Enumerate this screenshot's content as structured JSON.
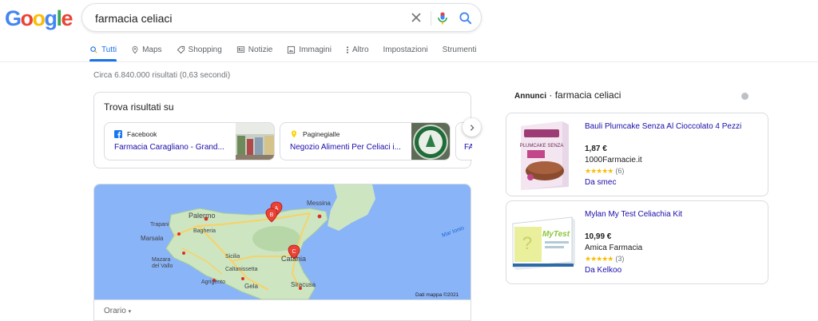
{
  "logo": {
    "letters": [
      "G",
      "o",
      "o",
      "g",
      "l",
      "e"
    ]
  },
  "search": {
    "query": "farmacia celiaci"
  },
  "tabs": [
    {
      "label": "Tutti",
      "icon": "search-icon"
    },
    {
      "label": "Maps",
      "icon": "map-pin-icon"
    },
    {
      "label": "Shopping",
      "icon": "tag-icon"
    },
    {
      "label": "Notizie",
      "icon": "newspaper-icon"
    },
    {
      "label": "Immagini",
      "icon": "image-icon"
    },
    {
      "label": "Altro",
      "icon": "more-vert-icon"
    },
    {
      "label": "Impostazioni"
    },
    {
      "label": "Strumenti"
    }
  ],
  "results": {
    "stats": "Circa 6.840.000 risultati (0,63 secondi)"
  },
  "find": {
    "title": "Trova risultati su",
    "cards": [
      {
        "source": "Facebook",
        "link": "Farmacia Caragliano - Grand..."
      },
      {
        "source": "Paginegialle",
        "link": "Negozio Alimenti Per Celiaci i..."
      },
      {
        "source": "",
        "link": "FAI"
      }
    ]
  },
  "map": {
    "cities": [
      "Palermo",
      "Trapani",
      "Marsala",
      "Mazara del Vallo",
      "Bagheria",
      "Sicilia",
      "Caltanissetta",
      "Agrigento",
      "Gela",
      "Siracusa",
      "Catania",
      "Messina"
    ],
    "sea": "Mar Ionio",
    "markers": [
      "A",
      "B",
      "C"
    ],
    "credit": "Dati mappa ©2021",
    "filter_label": "Orario"
  },
  "ads": {
    "label": "Annunci",
    "query": "farmacia celiaci",
    "items": [
      {
        "title": "Bauli Plumcake Senza Al Cioccolato 4 Pezzi",
        "price": "1,87 €",
        "store": "1000Farmacie.it",
        "stars": "★★★★★",
        "reviews": "(6)",
        "via": "Da smec",
        "img_text": "PLUMCAKE SENZA"
      },
      {
        "title": "Mylan My Test Celiachia Kit",
        "price": "10,99 €",
        "store": "Amica Farmacia",
        "stars": "★★★★★",
        "reviews": "(3)",
        "via": "Da Kelkoo",
        "img_text": "MyTest"
      }
    ]
  }
}
